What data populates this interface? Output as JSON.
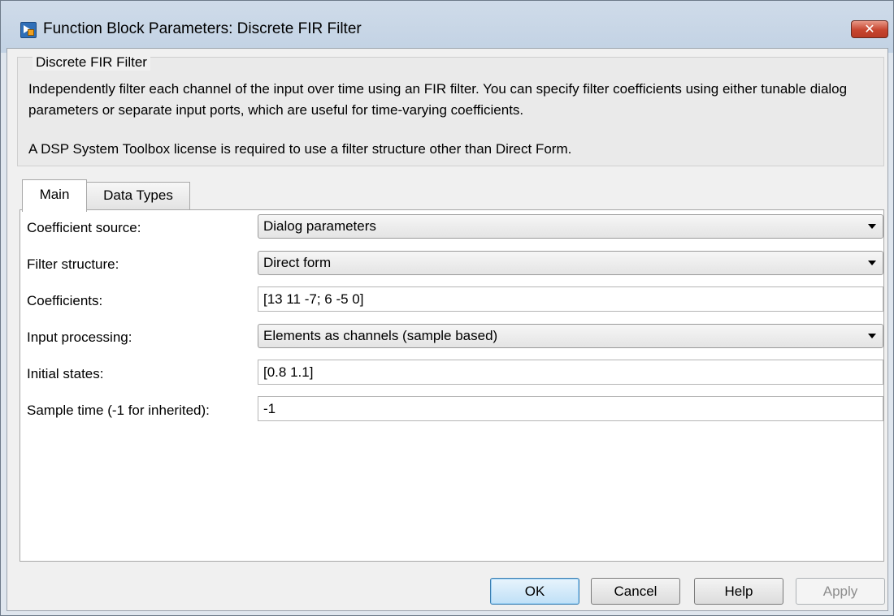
{
  "window": {
    "title": "Function Block Parameters: Discrete FIR Filter",
    "close_glyph": "✕"
  },
  "block": {
    "name": "Discrete FIR Filter",
    "description": "Independently filter each channel of the input over time using an FIR filter. You can specify filter coefficients using either tunable dialog parameters or separate input ports, which are useful for time-varying coefficients.",
    "license_note": "A DSP System Toolbox license is required to use a filter structure other than Direct Form."
  },
  "tabs": [
    {
      "label": "Main",
      "active": true
    },
    {
      "label": "Data Types",
      "active": false
    }
  ],
  "params": {
    "coefficient_source": {
      "label": "Coefficient source:",
      "value": "Dialog parameters"
    },
    "filter_structure": {
      "label": "Filter structure:",
      "value": "Direct form"
    },
    "coefficients": {
      "label": "Coefficients:",
      "value": "[13 11 -7; 6 -5 0]"
    },
    "input_processing": {
      "label": "Input processing:",
      "value": "Elements as channels (sample based)"
    },
    "initial_states": {
      "label": "Initial states:",
      "value": "[0.8 1.1]"
    },
    "sample_time": {
      "label": "Sample time (-1 for inherited):",
      "value": "-1"
    }
  },
  "buttons": {
    "ok": "OK",
    "cancel": "Cancel",
    "help": "Help",
    "apply": "Apply"
  },
  "colors": {
    "default_button_border": "#3c7fb1",
    "close_button": "#c7452f"
  }
}
